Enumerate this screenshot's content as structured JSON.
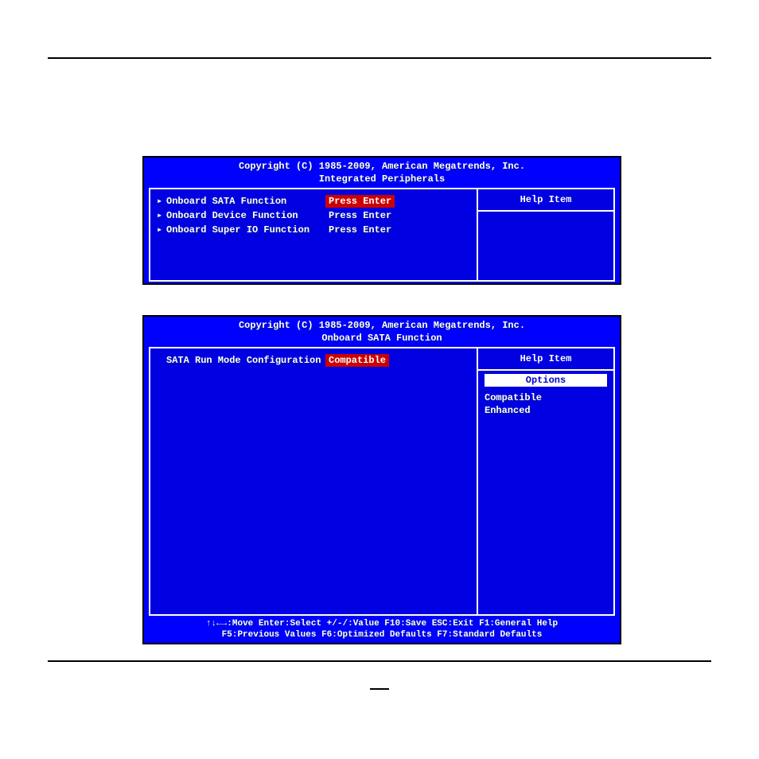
{
  "copyright": "Copyright (C) 1985-2009, American Megatrends, Inc.",
  "screen1": {
    "title": "Integrated Peripherals",
    "help_title": "Help Item",
    "items": [
      {
        "label": "Onboard SATA Function",
        "value": "Press Enter",
        "selected": true
      },
      {
        "label": "Onboard Device Function",
        "value": "Press Enter",
        "selected": false
      },
      {
        "label": "Onboard Super IO Function",
        "value": "Press Enter",
        "selected": false
      }
    ]
  },
  "screen2": {
    "title": "Onboard SATA Function",
    "help_title": "Help Item",
    "options_header": "Options",
    "items": [
      {
        "label": "SATA Run Mode Configuration",
        "value": "Compatible",
        "selected": true
      }
    ],
    "options": [
      "Compatible",
      "Enhanced"
    ]
  },
  "footer": {
    "line1": "↑↓←→:Move  Enter:Select  +/-/:Value  F10:Save  ESC:Exit  F1:General Help",
    "line2": "F5:Previous Values    F6:Optimized Defaults    F7:Standard Defaults"
  }
}
